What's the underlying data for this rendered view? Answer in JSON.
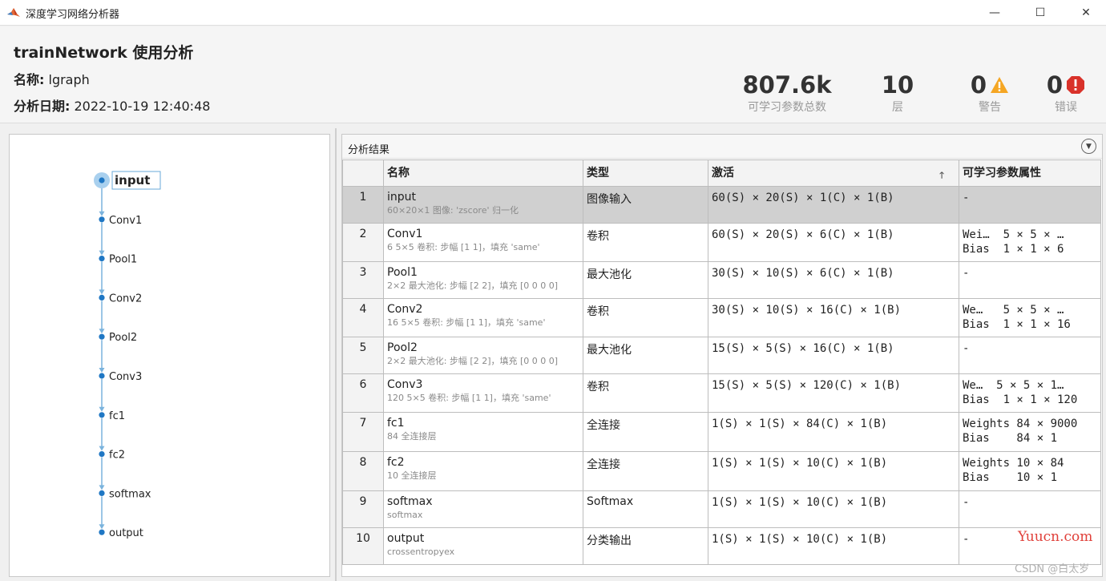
{
  "window": {
    "title": "深度学习网络分析器",
    "controls": {
      "minimize": "—",
      "maximize": "☐",
      "close": "✕"
    }
  },
  "summary": {
    "title": "trainNetwork 使用分析",
    "name_label": "名称:",
    "name_value": "lgraph",
    "date_label": "分析日期:",
    "date_value": "2022-10-19 12:40:48",
    "stats": {
      "params_value": "807.6k",
      "params_label": "可学习参数总数",
      "layers_value": "10",
      "layers_label": "层",
      "warnings_value": "0",
      "warnings_label": "警告",
      "errors_value": "0",
      "errors_label": "错误"
    }
  },
  "graph": {
    "nodes": [
      "input",
      "Conv1",
      "Pool1",
      "Conv2",
      "Pool2",
      "Conv3",
      "fc1",
      "fc2",
      "softmax",
      "output"
    ],
    "selected": "input",
    "colors": {
      "node": "#1f77c4",
      "edge": "#7ab3dd",
      "selected_fill": "#a9d0ee"
    }
  },
  "results": {
    "title": "分析结果",
    "columns": {
      "name": "名称",
      "type": "类型",
      "activation": "激活",
      "params": "可学习参数属性"
    },
    "rows": [
      {
        "index": "1",
        "name": "input",
        "desc": "60×20×1 图像: 'zscore' 归一化",
        "type": "图像输入",
        "activation": "60(S) × 20(S) × 1(C) × 1(B)",
        "params": "-"
      },
      {
        "index": "2",
        "name": "Conv1",
        "desc": "6 5×5 卷积: 步幅 [1 1]，填充 'same'",
        "type": "卷积",
        "activation": "60(S) × 20(S) × 6(C) × 1(B)",
        "params": "Wei…  5 × 5 × …\nBias  1 × 1 × 6"
      },
      {
        "index": "3",
        "name": "Pool1",
        "desc": "2×2 最大池化: 步幅 [2 2]，填充 [0 0 0 0]",
        "type": "最大池化",
        "activation": "30(S) × 10(S) × 6(C) × 1(B)",
        "params": "-"
      },
      {
        "index": "4",
        "name": "Conv2",
        "desc": "16 5×5 卷积: 步幅 [1 1]，填充 'same'",
        "type": "卷积",
        "activation": "30(S) × 10(S) × 16(C) × 1(B)",
        "params": "We…   5 × 5 × …\nBias  1 × 1 × 16"
      },
      {
        "index": "5",
        "name": "Pool2",
        "desc": "2×2 最大池化: 步幅 [2 2]，填充 [0 0 0 0]",
        "type": "最大池化",
        "activation": "15(S) × 5(S) × 16(C) × 1(B)",
        "params": "-"
      },
      {
        "index": "6",
        "name": "Conv3",
        "desc": "120 5×5 卷积: 步幅 [1 1]，填充 'same'",
        "type": "卷积",
        "activation": "15(S) × 5(S) × 120(C) × 1(B)",
        "params": "We…  5 × 5 × 1…\nBias  1 × 1 × 120"
      },
      {
        "index": "7",
        "name": "fc1",
        "desc": "84 全连接层",
        "type": "全连接",
        "activation": "1(S) × 1(S) × 84(C) × 1(B)",
        "params": "Weights 84 × 9000\nBias    84 × 1"
      },
      {
        "index": "8",
        "name": "fc2",
        "desc": "10 全连接层",
        "type": "全连接",
        "activation": "1(S) × 1(S) × 10(C) × 1(B)",
        "params": "Weights 10 × 84\nBias    10 × 1"
      },
      {
        "index": "9",
        "name": "softmax",
        "desc": "softmax",
        "type": "Softmax",
        "activation": "1(S) × 1(S) × 10(C) × 1(B)",
        "params": "-"
      },
      {
        "index": "10",
        "name": "output",
        "desc": "crossentropyex",
        "type": "分类输出",
        "activation": "1(S) × 1(S) × 10(C) × 1(B)",
        "params": "-"
      }
    ]
  },
  "watermark": {
    "site": "Yuucn.com",
    "credit": "CSDN @白太岁"
  },
  "theme": {
    "warning": "#f5a623",
    "error": "#d9322a"
  }
}
